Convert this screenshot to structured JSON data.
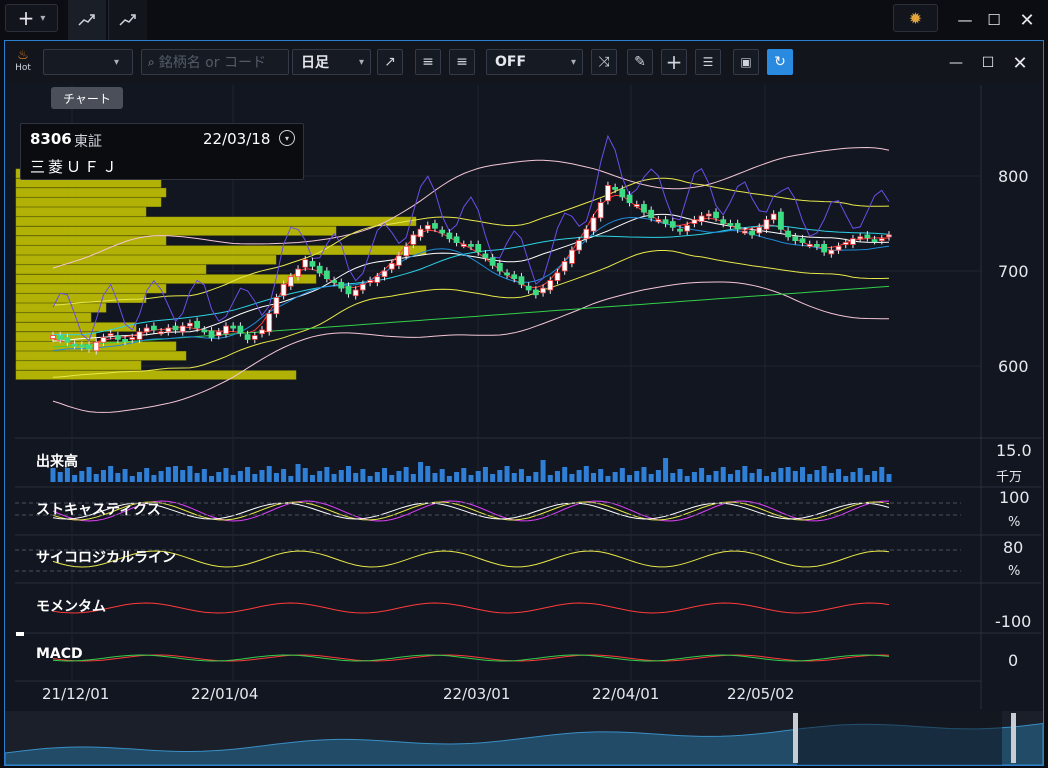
{
  "topbar": {
    "tab_tooltip": "チャート"
  },
  "toolbar": {
    "hot_label": "Hot",
    "search_placeholder": "銘柄名 or コード",
    "period": "日足",
    "overlay": "OFF"
  },
  "info": {
    "code": "8306",
    "exchange": "東証",
    "date": "22/03/18",
    "name": "三菱ＵＦＪ"
  },
  "panels": {
    "volume": "出来高",
    "stochastics": "ストキャスティクス",
    "psychological": "サイコロジカルライン",
    "momentum": "モメンタム",
    "macd": "MACD"
  },
  "axis": {
    "price_800": "800",
    "price_700": "700",
    "price_600": "600",
    "volume_max": "15.0",
    "volume_unit": "千万",
    "stoch_max": "100",
    "stoch_unit": "%",
    "psy_max": "80",
    "psy_unit": "%",
    "momentum_val": "-100",
    "macd_val": "0"
  },
  "dates": [
    "21/12/01",
    "22/01/04",
    "22/03/01",
    "22/04/01",
    "22/05/02"
  ],
  "colors": {
    "accent": "#2a8ae0",
    "up": "#ff3b3b",
    "down": "#3ddc84",
    "volume_profile": "#d4d400",
    "bg": "#121620"
  },
  "chart_data": {
    "type": "candlestick",
    "ylim": [
      560,
      900
    ],
    "yticks": [
      600,
      700,
      800
    ],
    "close": [
      632,
      628,
      625,
      622,
      620,
      618,
      625,
      630,
      634,
      628,
      626,
      630,
      636,
      640,
      638,
      636,
      640,
      638,
      642,
      645,
      640,
      637,
      630,
      636,
      642,
      640,
      635,
      628,
      632,
      638,
      655,
      672,
      686,
      694,
      702,
      712,
      705,
      698,
      692,
      688,
      682,
      676,
      680,
      686,
      690,
      694,
      700,
      708,
      716,
      726,
      738,
      744,
      748,
      745,
      740,
      734,
      730,
      728,
      726,
      720,
      714,
      706,
      700,
      696,
      692,
      686,
      680,
      675,
      682,
      690,
      698,
      710,
      722,
      732,
      744,
      756,
      772,
      790,
      786,
      778,
      772,
      770,
      762,
      756,
      754,
      750,
      746,
      742,
      748,
      754,
      758,
      760,
      756,
      750,
      748,
      744,
      742,
      738,
      746,
      754,
      760,
      744,
      736,
      732,
      730,
      728,
      726,
      720,
      722,
      726,
      730,
      734,
      736,
      735,
      732,
      734,
      738
    ]
  }
}
